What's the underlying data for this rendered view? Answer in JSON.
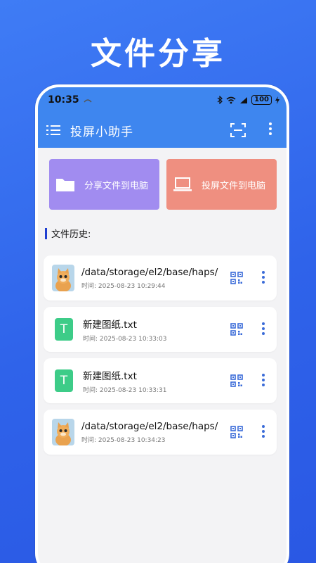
{
  "headline": "文件分享",
  "status": {
    "time": "10:35",
    "battery": "100"
  },
  "toolbar": {
    "title": "投屏小助手"
  },
  "actions": [
    {
      "label": "分享文件到电脑",
      "color": "#a18cf0",
      "icon": "folder-icon"
    },
    {
      "label": "投屏文件到电脑",
      "color": "#ef8f80",
      "icon": "laptop-icon"
    }
  ],
  "history": {
    "title": "文件历史:",
    "items": [
      {
        "name": "/data/storage/el2/base/haps/",
        "time_label": "时间:",
        "time": "2025-08-23 10:29:44",
        "type": "image"
      },
      {
        "name": "新建图纸.txt",
        "time_label": "时间:",
        "time": "2025-08-23 10:33:03",
        "type": "txt"
      },
      {
        "name": "新建图纸.txt",
        "time_label": "时间:",
        "time": "2025-08-23 10:33:31",
        "type": "txt"
      },
      {
        "name": "/data/storage/el2/base/haps/",
        "time_label": "时间:",
        "time": "2025-08-23 10:34:23",
        "type": "image"
      }
    ],
    "txt_glyph": "T"
  }
}
